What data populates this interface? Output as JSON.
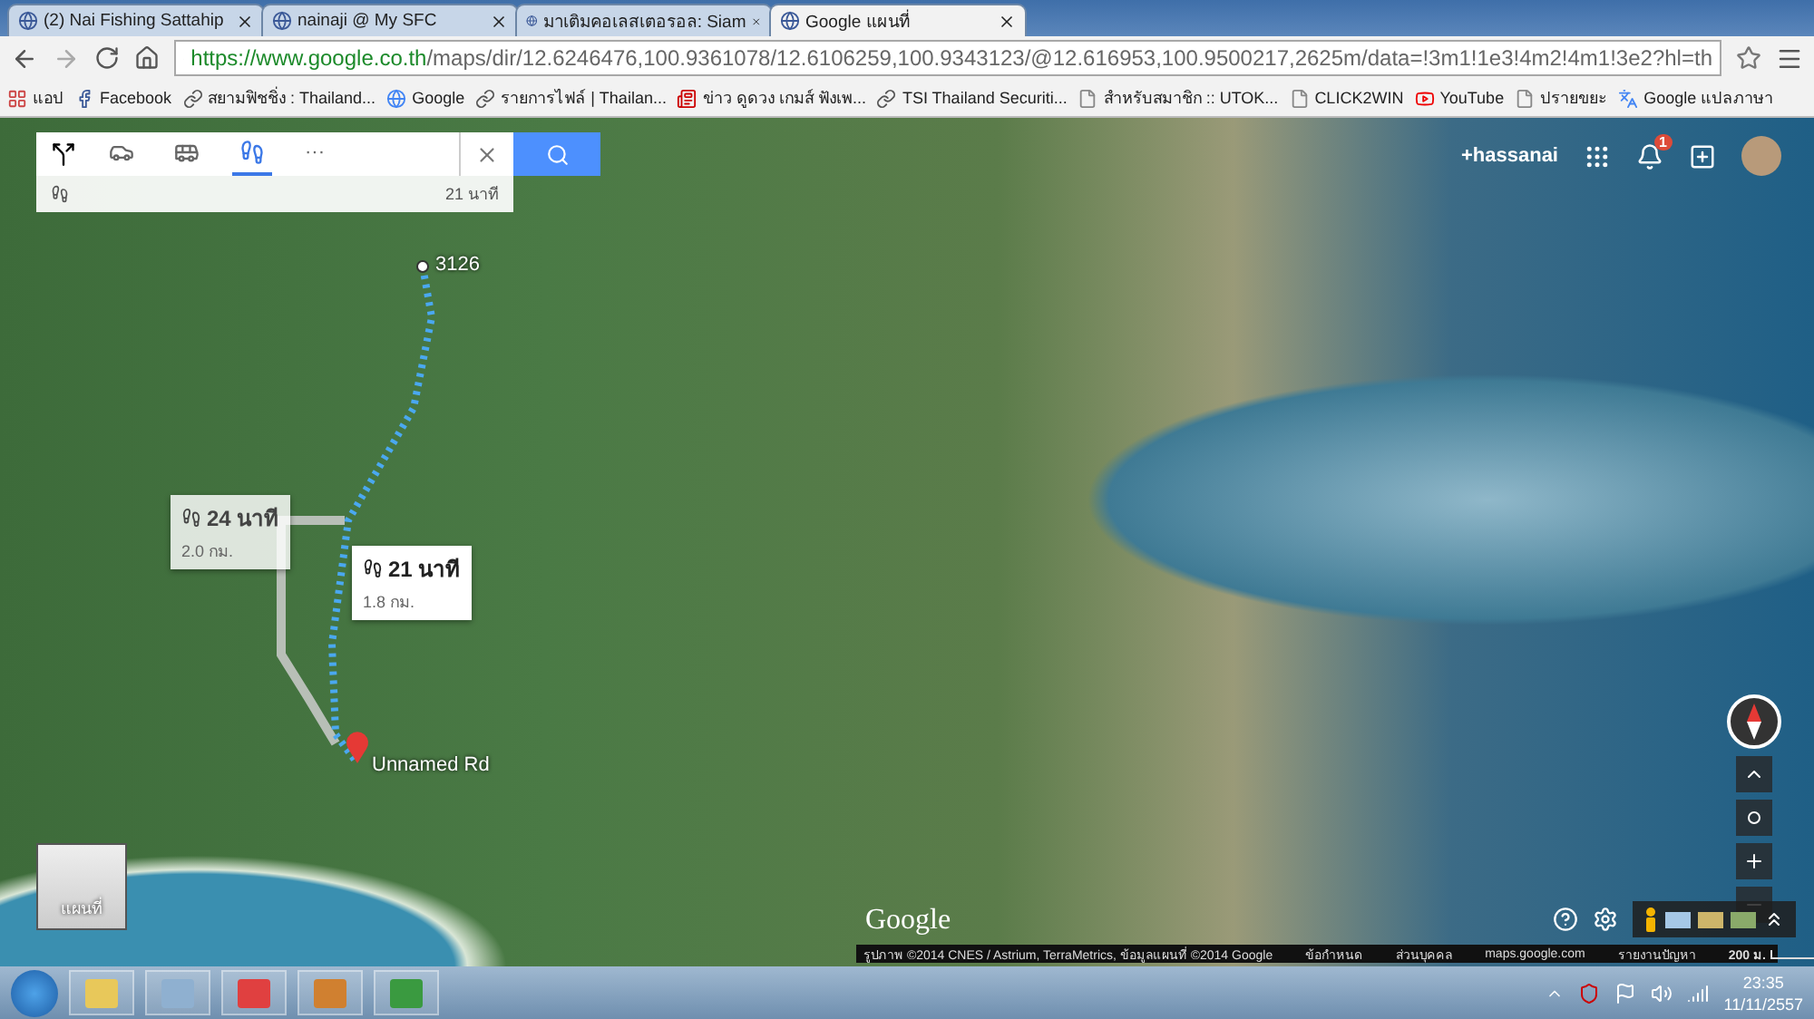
{
  "browser": {
    "tabs": [
      {
        "title": "(2) Nai Fishing Sattahip",
        "selected": false
      },
      {
        "title": "nainaji @ My SFC",
        "selected": false
      },
      {
        "title": "มาเติมคอเลสเตอรอล: Siam",
        "selected": false
      },
      {
        "title": "Google แผนที่",
        "selected": true
      }
    ],
    "url_host": "https://www.google.co.th",
    "url_path": "/maps/dir/12.6246476,100.9361078/12.6106259,100.9343123/@12.616953,100.9500217,2625m/data=!3m1!1e3!4m2!4m1!3e2?hl=th",
    "bookmarks": [
      {
        "label": "แอป",
        "kind": "apps"
      },
      {
        "label": "Facebook",
        "kind": "facebook"
      },
      {
        "label": "สยามฟิชชิ่ง : Thailand...",
        "kind": "site"
      },
      {
        "label": "Google",
        "kind": "google"
      },
      {
        "label": "รายการไฟล์ | Thailan...",
        "kind": "site"
      },
      {
        "label": "ข่าว ดูดวง เกมส์ ฟังเพ...",
        "kind": "news"
      },
      {
        "label": "TSI Thailand Securiti...",
        "kind": "site"
      },
      {
        "label": "สำหรับสมาชิก :: UTOK...",
        "kind": "page"
      },
      {
        "label": "CLICK2WIN",
        "kind": "page"
      },
      {
        "label": "YouTube",
        "kind": "youtube"
      },
      {
        "label": "ปรายขยะ",
        "kind": "page"
      },
      {
        "label": "Google แปลภาษา",
        "kind": "translate"
      }
    ]
  },
  "directions": {
    "modes": [
      {
        "kind": "car",
        "selected": false
      },
      {
        "kind": "transit",
        "selected": false
      },
      {
        "kind": "walk",
        "selected": true
      },
      {
        "kind": "more",
        "selected": false
      }
    ],
    "more_label": "···",
    "summary_time": "21 นาที"
  },
  "account": {
    "name": "+hassanai",
    "notifications": "1"
  },
  "map": {
    "start_label": "3126",
    "end_label": "Unnamed Rd",
    "routes": [
      {
        "time": "24 นาที",
        "distance": "2.0 กม.",
        "selected": false
      },
      {
        "time": "21 นาที",
        "distance": "1.8 กม.",
        "selected": true
      }
    ],
    "logo": "Google",
    "thumbnail_label": "แผนที่",
    "footer": [
      "รูปภาพ ©2014 CNES / Astrium, TerraMetrics, ข้อมูลแผนที่ ©2014 Google",
      "ข้อกำหนด",
      "ส่วนบุคคล",
      "maps.google.com",
      "รายงานปัญหา"
    ],
    "scale": "200 ม."
  },
  "taskbar": {
    "time": "23:35",
    "date": "11/11/2557"
  }
}
